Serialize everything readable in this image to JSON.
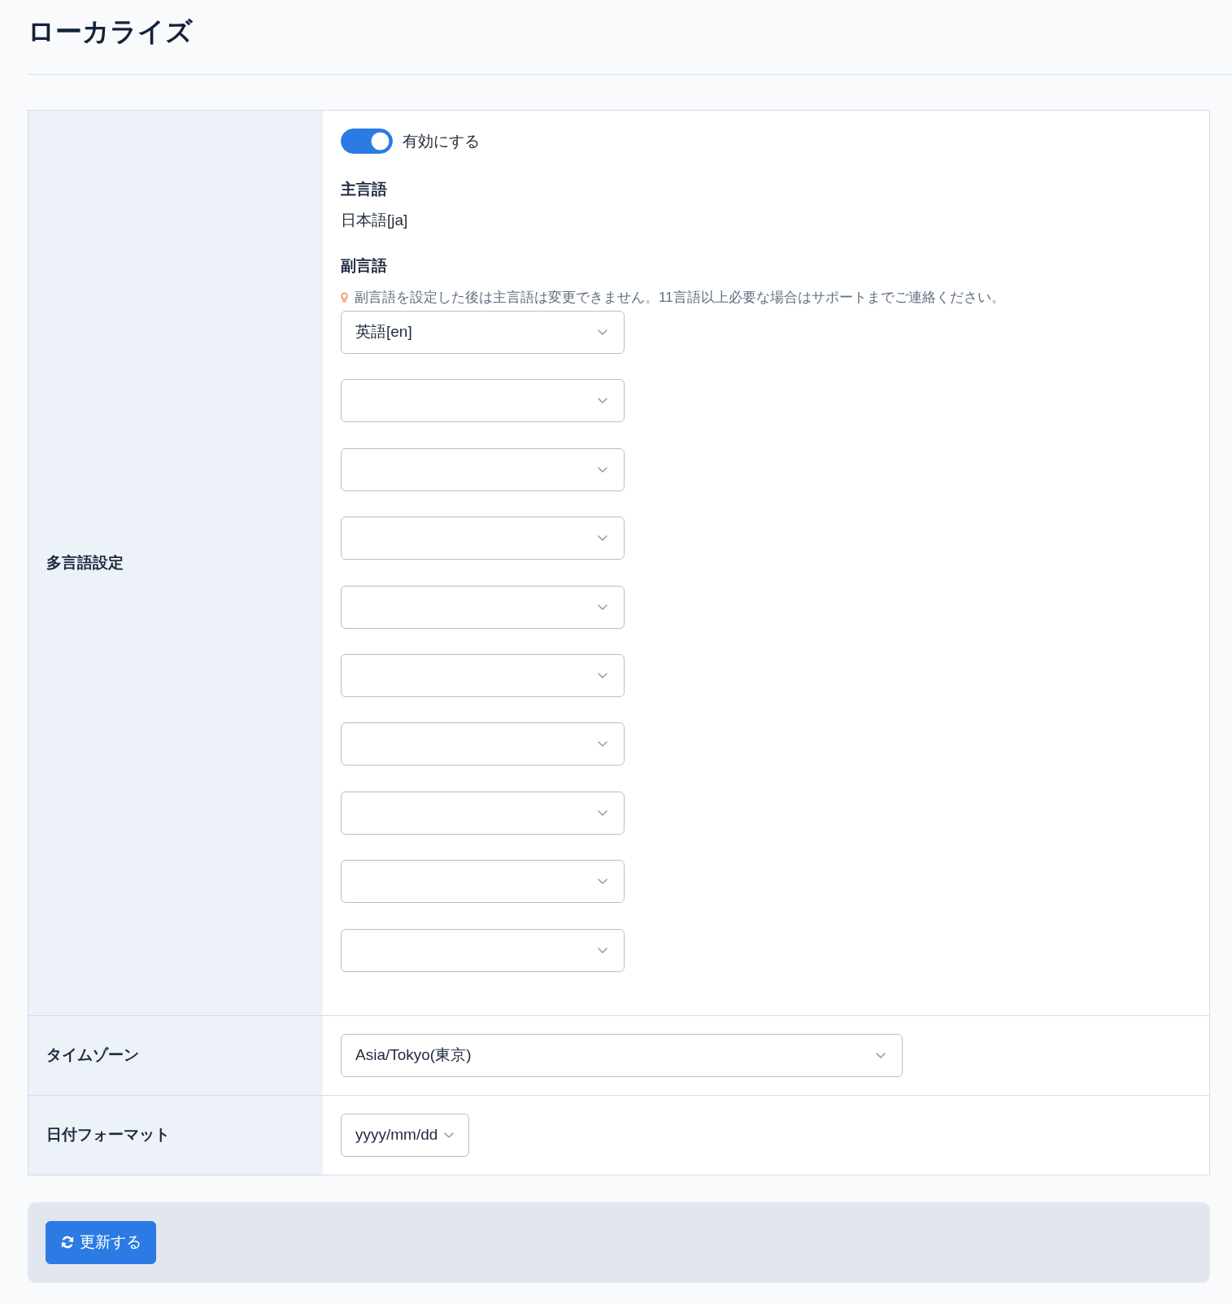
{
  "page": {
    "title": "ローカライズ"
  },
  "settings": [
    {
      "kind": "multilingual",
      "label": "多言語設定",
      "toggle": {
        "label": "有効にする",
        "on": true
      },
      "primary_language": {
        "heading": "主言語",
        "value": "日本語[ja]"
      },
      "secondary_languages": {
        "heading": "副言語",
        "hint": "副言語を設定した後は主言語は変更できません。11言語以上必要な場合はサポートまでご連絡ください。",
        "selects": [
          {
            "kind": "select",
            "value": "英語[en]"
          },
          {
            "kind": "select"
          },
          {
            "kind": "select"
          },
          {
            "kind": "select"
          },
          {
            "kind": "select"
          },
          {
            "kind": "select"
          },
          {
            "kind": "select"
          },
          {
            "kind": "select"
          },
          {
            "kind": "select"
          },
          {
            "kind": "select"
          }
        ]
      }
    },
    {
      "kind": "select",
      "label": "タイムゾーン",
      "value": "Asia/Tokyo(東京)"
    },
    {
      "kind": "compact_select",
      "label": "日付フォーマット",
      "value": "yyyy/mm/dd"
    }
  ],
  "footer": {
    "submit_button": {
      "label": "更新する"
    }
  }
}
